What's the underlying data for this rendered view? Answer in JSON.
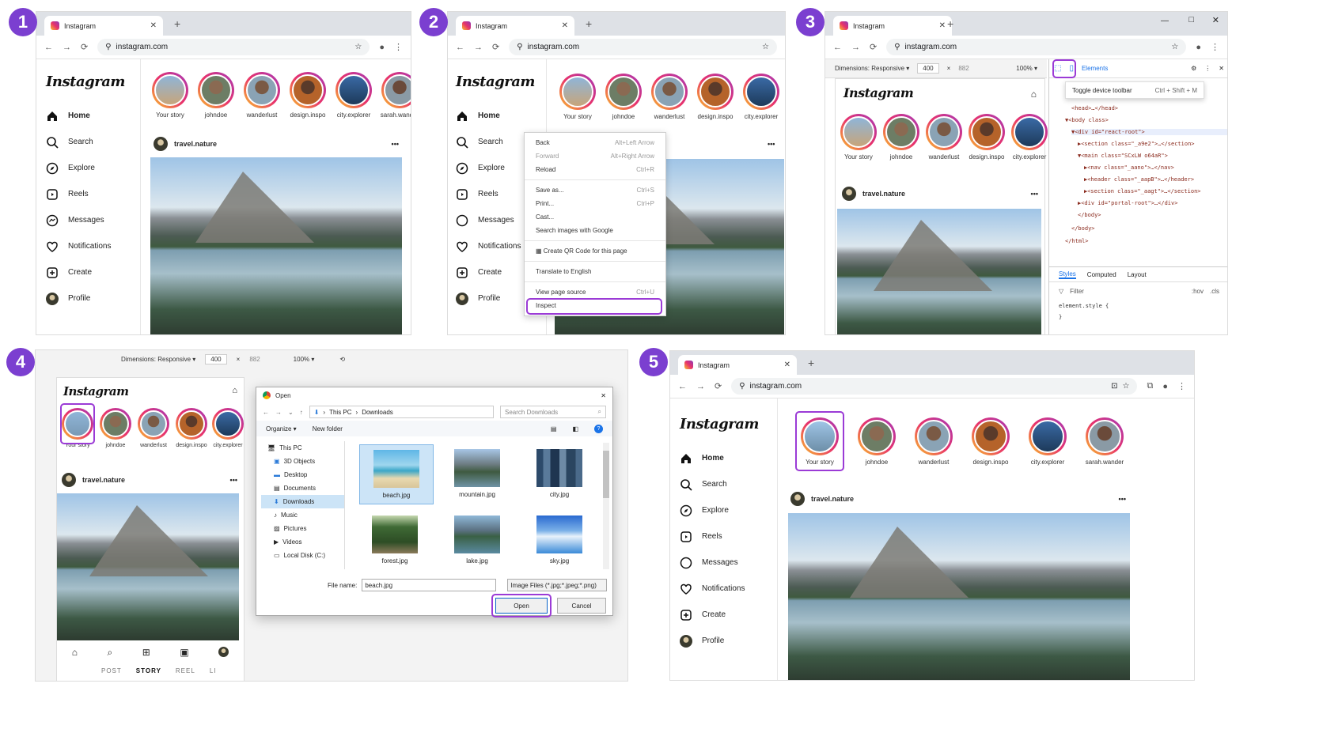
{
  "steps": [
    "1",
    "2",
    "3",
    "4",
    "5"
  ],
  "browser": {
    "tab_title": "Instagram",
    "url": "instagram.com",
    "new_tab": "+"
  },
  "instagram": {
    "logo": "Instagram",
    "nav": [
      "Home",
      "Search",
      "Explore",
      "Reels",
      "Messages",
      "Notifications",
      "Create",
      "Profile"
    ],
    "stories": [
      "Your story",
      "johndoe",
      "wanderlust",
      "design.inspo",
      "city.explorer",
      "sarah.wander"
    ],
    "post_user": "travel.nature",
    "more": "•••"
  },
  "context_menu": {
    "items": [
      {
        "label": "Back",
        "shortcut": "Alt+Left Arrow"
      },
      {
        "label": "Forward",
        "shortcut": "Alt+Right Arrow"
      },
      {
        "label": "Reload",
        "shortcut": "Ctrl+R"
      },
      {
        "label": "Save as...",
        "shortcut": "Ctrl+S"
      },
      {
        "label": "Print...",
        "shortcut": "Ctrl+P"
      },
      {
        "label": "Cast...",
        "shortcut": ""
      },
      {
        "label": "Search images with Google",
        "shortcut": ""
      },
      {
        "label": "Create QR Code for this page",
        "shortcut": ""
      },
      {
        "label": "Translate to English",
        "shortcut": ""
      },
      {
        "label": "View page source",
        "shortcut": "Ctrl+U"
      },
      {
        "label": "Inspect",
        "shortcut": ""
      }
    ]
  },
  "devtools": {
    "dimensions": "Dimensions: Responsive ▾",
    "width": "400",
    "x": "×",
    "height": "882",
    "zoom": "100% ▾",
    "elements_tab": "Elements",
    "tooltip": "Toggle device toolbar",
    "tooltip_shortcut": "Ctrl + Shift + M",
    "dom": [
      "<head>…</head>",
      "▼<body class>",
      "▼<div id=\"react-root\">",
      "▶<section class=\"_a9e2\">…</section>",
      "▼<main class=\"SCxLW o64aR\">",
      "▶<nav class=\"_aano\">…</nav>",
      "▶<header class=\"_aapB\">…</header>",
      "▶<section class=\"_aagt\">…</section>",
      "▶<div id=\"portal-root\">…</div>",
      "</body>",
      "</body>",
      "</html>"
    ],
    "style_tabs": [
      "Styles",
      "Computed",
      "Layout"
    ],
    "filter": "Filter",
    "hov": ":hov",
    "cls": ".cls",
    "element_style": "element.style {",
    "close_brace": "}"
  },
  "dialog": {
    "title": "Open",
    "path": [
      "This PC",
      "Downloads"
    ],
    "search_placeholder": "Search Downloads",
    "organize": "Organize ▾",
    "new_folder": "New folder",
    "tree": [
      "This PC",
      "3D Objects",
      "Desktop",
      "Documents",
      "Downloads",
      "Music",
      "Pictures",
      "Videos",
      "Local Disk (C:)"
    ],
    "files": [
      "beach.jpg",
      "mountain.jpg",
      "city.jpg",
      "forest.jpg",
      "lake.jpg",
      "sky.jpg"
    ],
    "file_name_label": "File name:",
    "file_name": "beach.jpg",
    "file_type": "Image Files (*.jpg;*.jpeg;*.png)",
    "open": "Open",
    "cancel": "Cancel"
  },
  "mobile_nav": [
    "POST",
    "STORY",
    "REEL",
    "LI"
  ],
  "colors": {
    "accent": "#9b3bd6",
    "badge": "#7b3fd0",
    "devtools_blue": "#1a73e8"
  }
}
